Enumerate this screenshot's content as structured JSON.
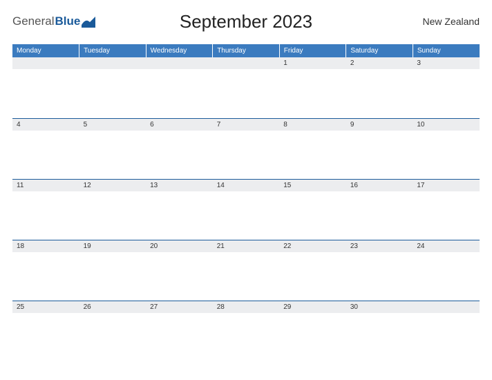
{
  "logo": {
    "text1": "General",
    "text2": "Blue"
  },
  "title": "September 2023",
  "region": "New Zealand",
  "colors": {
    "accent": "#3b7bbf",
    "border": "#1a5a9a",
    "shade": "#ecedef"
  },
  "weekdays": [
    "Monday",
    "Tuesday",
    "Wednesday",
    "Thursday",
    "Friday",
    "Saturday",
    "Sunday"
  ],
  "weeks": [
    [
      "",
      "",
      "",
      "",
      "1",
      "2",
      "3"
    ],
    [
      "4",
      "5",
      "6",
      "7",
      "8",
      "9",
      "10"
    ],
    [
      "11",
      "12",
      "13",
      "14",
      "15",
      "16",
      "17"
    ],
    [
      "18",
      "19",
      "20",
      "21",
      "22",
      "23",
      "24"
    ],
    [
      "25",
      "26",
      "27",
      "28",
      "29",
      "30",
      ""
    ]
  ]
}
